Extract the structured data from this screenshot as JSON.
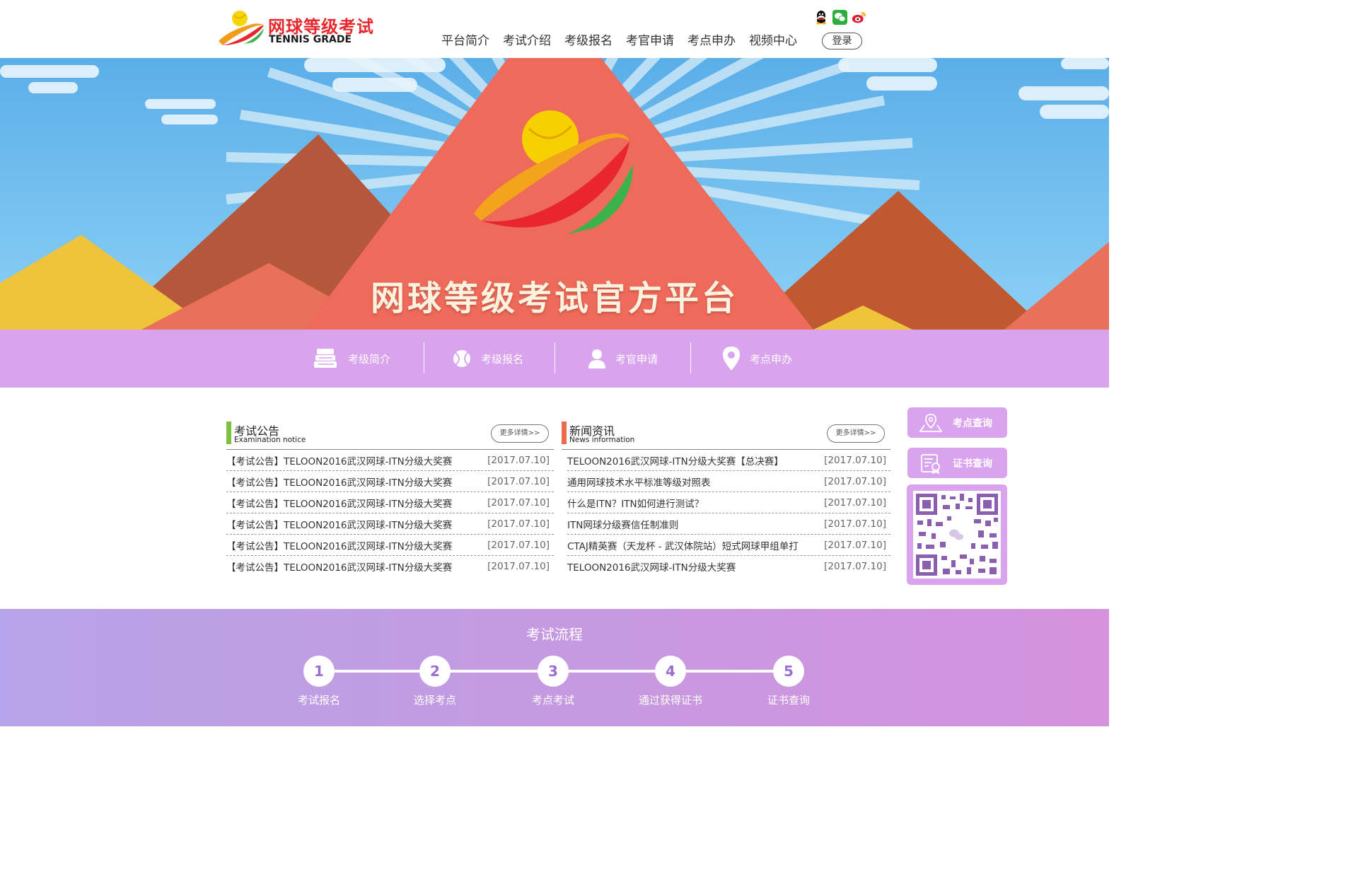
{
  "header": {
    "logo_cn": "网球等级考试",
    "logo_en": "TENNIS GRADE",
    "social": [
      "qq-icon",
      "wechat-icon",
      "weibo-icon"
    ],
    "nav": [
      "平台简介",
      "考试介绍",
      "考级报名",
      "考官申请",
      "考点申办",
      "视频中心"
    ],
    "login": "登录"
  },
  "banner": {
    "title": "网球等级考试官方平台"
  },
  "quick_links": [
    {
      "label": "考级简介",
      "icon": "books-icon"
    },
    {
      "label": "考级报名",
      "icon": "tennis-ball-icon"
    },
    {
      "label": "考官申请",
      "icon": "user-icon"
    },
    {
      "label": "考点申办",
      "icon": "location-pin-icon"
    }
  ],
  "notice": {
    "title": "考试公告",
    "subtitle": "Examination notice",
    "more": "更多详情>>",
    "accent": "#7dc23f",
    "items": [
      {
        "text": "【考试公告】TELOON2016武汉网球-ITN分级大奖赛",
        "date": "[2017.07.10]"
      },
      {
        "text": "【考试公告】TELOON2016武汉网球-ITN分级大奖赛",
        "date": "[2017.07.10]"
      },
      {
        "text": "【考试公告】TELOON2016武汉网球-ITN分级大奖赛",
        "date": "[2017.07.10]"
      },
      {
        "text": "【考试公告】TELOON2016武汉网球-ITN分级大奖赛",
        "date": "[2017.07.10]"
      },
      {
        "text": "【考试公告】TELOON2016武汉网球-ITN分级大奖赛",
        "date": "[2017.07.10]"
      },
      {
        "text": "【考试公告】TELOON2016武汉网球-ITN分级大奖赛",
        "date": "[2017.07.10]"
      }
    ]
  },
  "news": {
    "title": "新闻资讯",
    "subtitle": "News information",
    "more": "更多详情>>",
    "accent": "#ee6a4f",
    "items": [
      {
        "text": "TELOON2016武汉网球-ITN分级大奖赛【总决赛】",
        "date": "[2017.07.10]"
      },
      {
        "text": "通用网球技术水平标准等级对照表",
        "date": "[2017.07.10]"
      },
      {
        "text": "什么是ITN？ITN如何进行测试？",
        "date": "[2017.07.10]"
      },
      {
        "text": "ITN网球分级赛信任制准则",
        "date": "[2017.07.10]"
      },
      {
        "text": "CTAJ精英赛（天龙杯 - 武汉体院站）短式网球甲组单打",
        "date": "[2017.07.10]"
      },
      {
        "text": "TELOON2016武汉网球-ITN分级大奖赛",
        "date": "[2017.07.10]"
      }
    ]
  },
  "sidebar": {
    "exam_site_query": "考点查询",
    "certificate_query": "证书查询",
    "qr_code": "qr-code-icon"
  },
  "process": {
    "title": "考试流程",
    "steps": [
      {
        "num": "1",
        "label": "考试报名"
      },
      {
        "num": "2",
        "label": "选择考点"
      },
      {
        "num": "3",
        "label": "考点考试"
      },
      {
        "num": "4",
        "label": "通过获得证书"
      },
      {
        "num": "5",
        "label": "证书查询"
      }
    ]
  },
  "colors": {
    "lilac": "#d9a3ee",
    "brand_red": "#e8262c"
  }
}
